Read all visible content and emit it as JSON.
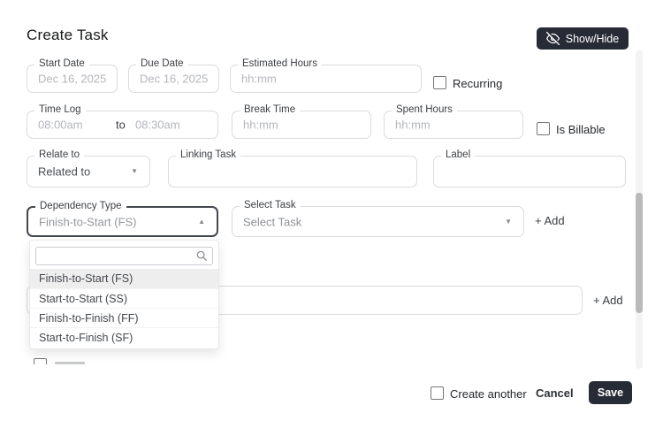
{
  "header": {
    "title": "Create Task",
    "show_hide_label": "Show/Hide"
  },
  "fields": {
    "start_date": {
      "label": "Start Date",
      "placeholder": "Dec 16, 2025"
    },
    "due_date": {
      "label": "Due Date",
      "placeholder": "Dec 16, 2025"
    },
    "estimated_hours": {
      "label": "Estimated Hours",
      "placeholder": "hh:mm"
    },
    "recurring": {
      "label": "Recurring",
      "checked": false
    },
    "time_log": {
      "label": "Time Log",
      "start_placeholder": "08:00am",
      "separator": "to",
      "end_placeholder": "08:30am"
    },
    "break_time": {
      "label": "Break Time",
      "placeholder": "hh:mm"
    },
    "spent_hours": {
      "label": "Spent Hours",
      "placeholder": "hh:mm"
    },
    "is_billable": {
      "label": "Is Billable",
      "checked": false
    },
    "relate_to": {
      "label": "Relate to",
      "value": "Related to"
    },
    "linking_task": {
      "label": "Linking Task",
      "value": ""
    },
    "label": {
      "label": "Label",
      "value": ""
    },
    "dependency_type": {
      "label": "Dependency Type",
      "value": "Finish-to-Start (FS)"
    },
    "select_task": {
      "label": "Select Task",
      "value": "Select Task"
    },
    "add_task_label": "+ Add",
    "add_row_label": "+ Add"
  },
  "dependency_dropdown": {
    "search_placeholder": "",
    "options": [
      {
        "label": "Finish-to-Start (FS)",
        "highlighted": true
      },
      {
        "label": "Start-to-Start (SS)",
        "highlighted": false
      },
      {
        "label": "Finish-to-Finish (FF)",
        "highlighted": false
      },
      {
        "label": "Start-to-Finish (SF)",
        "highlighted": false
      }
    ]
  },
  "footer": {
    "create_another_label": "Create another",
    "create_another_checked": false,
    "cancel_label": "Cancel",
    "save_label": "Save"
  },
  "icons": {
    "chevron_down": "▼",
    "chevron_up": "▲"
  },
  "colors": {
    "primary_dark": "#272b35",
    "field_border": "#d9dbde",
    "focus_border": "#45484f",
    "placeholder_text": "#b4b6bb",
    "label_text": "#3c3f44",
    "value_text": "#4b4e54",
    "option_highlight": "#eeeeef",
    "scrollbar_thumb": "#b9babc"
  }
}
